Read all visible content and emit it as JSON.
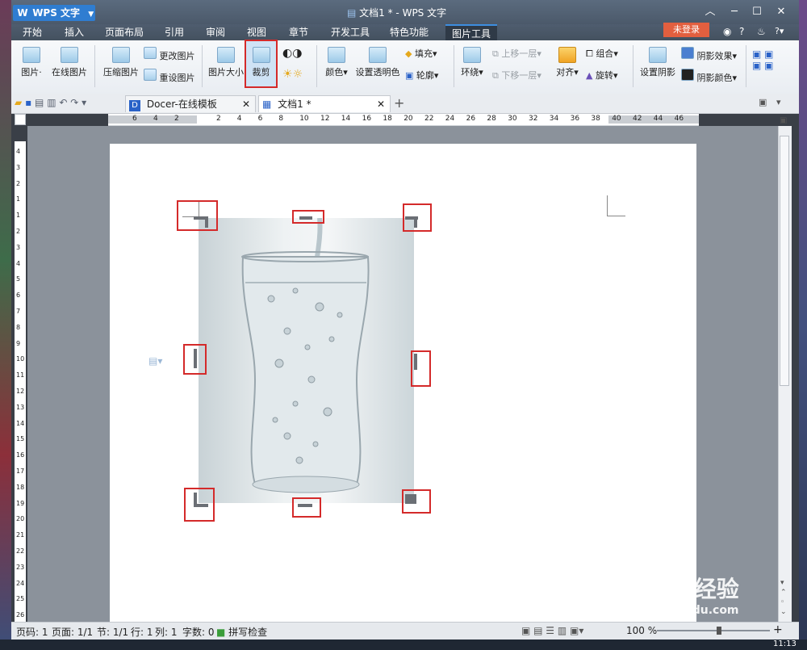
{
  "app": {
    "name": "WPS 文字",
    "window_title": "文档1 * - WPS 文字"
  },
  "menu_tabs": [
    "开始",
    "插入",
    "页面布局",
    "引用",
    "审阅",
    "视图",
    "章节",
    "开发工具",
    "特色功能",
    "图片工具"
  ],
  "login_label": "未登录",
  "ribbon": {
    "picture": "图片",
    "online_picture": "在线图片",
    "compress": "压缩图片",
    "change_picture": "更改图片",
    "reset_picture": "重设图片",
    "picture_size": "图片大小",
    "crop": "裁剪",
    "color": "颜色",
    "set_transparent": "设置透明色",
    "fill": "填充",
    "outline": "轮廓",
    "wrap": "环绕",
    "bring_forward": "上移一层",
    "send_backward": "下移一层",
    "group": "组合",
    "align": "对齐",
    "rotate": "旋转",
    "set_shadow": "设置阴影",
    "shadow_effect": "阴影效果",
    "shadow_color": "阴影颜色"
  },
  "doc_tabs": [
    {
      "label": "Docer-在线模板"
    },
    {
      "label": "文档1 *"
    }
  ],
  "ruler_h_left": [
    "6",
    "4",
    "2"
  ],
  "ruler_h_right": [
    "2",
    "4",
    "6",
    "8",
    "10",
    "12",
    "14",
    "16",
    "18",
    "20",
    "22",
    "24",
    "26",
    "28",
    "30",
    "32",
    "34",
    "36",
    "38",
    "40",
    "42",
    "44",
    "46"
  ],
  "ruler_v": [
    "4",
    "3",
    "2",
    "1",
    "1",
    "2",
    "3",
    "4",
    "5",
    "6",
    "7",
    "8",
    "9",
    "10",
    "11",
    "12",
    "13",
    "14",
    "15",
    "16",
    "17",
    "18",
    "19",
    "20",
    "21",
    "22",
    "23",
    "24",
    "25",
    "26"
  ],
  "status": {
    "page": "页码: 1",
    "pages": "页面: 1/1",
    "section": "节: 1/1",
    "row": "行: 1",
    "col": "列: 1",
    "words": "字数: 0",
    "spell": "拼写检查",
    "zoom": "100 %"
  },
  "clock": "11:13",
  "watermark": {
    "brand": "Baidu经验",
    "url": "jingyan.baidu.com"
  },
  "colors": {
    "highlight": "#d42a2a",
    "login": "#e25f3f",
    "app": "#2f7dd1"
  }
}
